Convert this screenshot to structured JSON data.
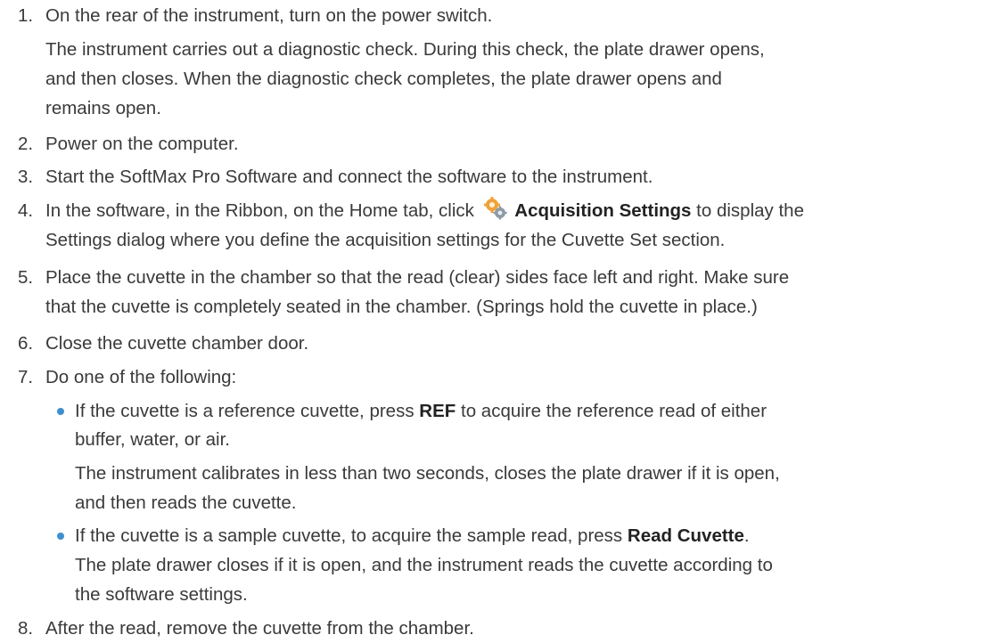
{
  "steps": [
    {
      "number": "1.",
      "lines": [
        "On the rear of the instrument, turn on the power switch.",
        "The instrument carries out a diagnostic check. During this check, the plate drawer opens,",
        "and then closes. When the diagnostic check completes, the plate drawer opens and",
        "remains open."
      ]
    },
    {
      "number": "2.",
      "lines": [
        "Power on the computer."
      ]
    },
    {
      "number": "3.",
      "lines": [
        "Start the SoftMax Pro Software and connect the software to the instrument."
      ]
    },
    {
      "number": "4.",
      "line1_pre": "In the software, in the Ribbon, on the Home tab, click",
      "line1_bold": "Acquisition Settings",
      "line1_post": "to display the",
      "line2": "Settings dialog where you define the acquisition settings for the Cuvette Set section.",
      "icon": "acquisition-settings-gear-icon"
    },
    {
      "number": "5.",
      "lines": [
        "Place the cuvette in the chamber so that the read (clear) sides face left and right. Make sure",
        "that the cuvette is completely seated in the chamber. (Springs hold the cuvette in place.)"
      ]
    },
    {
      "number": "6.",
      "lines": [
        "Close the cuvette chamber door."
      ]
    },
    {
      "number": "7.",
      "lines": [
        "Do one of the following:"
      ],
      "bullets": [
        {
          "pre": "If the cuvette is a reference cuvette, press",
          "bold": "REF",
          "post": "to acquire the reference read of either",
          "line2": "buffer, water, or air.",
          "note1": "The instrument calibrates in less than two seconds, closes the plate drawer if it is open,",
          "note2": "and then reads the cuvette."
        },
        {
          "pre": "If the cuvette is a sample cuvette, to acquire the sample read, press",
          "bold": "Read Cuvette",
          "post": ".",
          "note1": "The plate drawer closes if it is open, and the instrument reads the cuvette according to",
          "note2": "the software settings."
        }
      ]
    },
    {
      "number": "8.",
      "lines": [
        "After the read, remove the cuvette from the chamber."
      ]
    }
  ],
  "colors": {
    "text": "#3a3a3a",
    "bullet": "#3f8fce",
    "icon_orange": "#f0a23a",
    "icon_gray": "#8d9aa6"
  }
}
